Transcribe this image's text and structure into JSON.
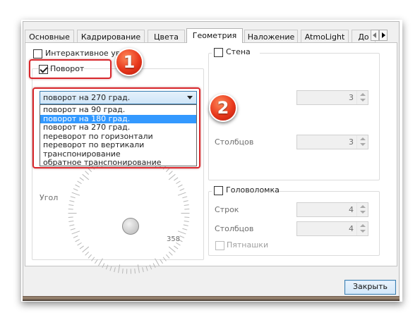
{
  "tabs": [
    {
      "label": "Основные",
      "active": false
    },
    {
      "label": "Кадрирование",
      "active": false
    },
    {
      "label": "Цвета",
      "active": false
    },
    {
      "label": "Геометрия",
      "active": true
    },
    {
      "label": "Наложение",
      "active": false
    },
    {
      "label": "AtmoLight",
      "active": false
    },
    {
      "label": "До",
      "active": false
    }
  ],
  "geometry": {
    "interactive_zoom": {
      "label": "Интерактивное увел",
      "checked": false
    },
    "rotate": {
      "label": "Поворот",
      "checked": true,
      "selected": "поворот на 270 град.",
      "options": [
        "поворот на 90 град.",
        "поворот на 180 град.",
        "поворот на 270 град.",
        "переворот по горизонтали",
        "переворот по вертикали",
        "транспонирование",
        "обратное транспонирование"
      ],
      "highlighted_option": "поворот на 180 град.",
      "angle_label": "Угол",
      "angle_value": "358"
    },
    "wall": {
      "label": "Стена",
      "checked": false,
      "columns_label": "Столбцов",
      "rows_value": "3",
      "columns_value": "3"
    },
    "puzzle": {
      "label": "Головоломка",
      "checked": false,
      "rows_label": "Строк",
      "rows_value": "4",
      "columns_label": "Столбцов",
      "columns_value": "4",
      "fifteen_label": "Пятнашки",
      "fifteen_checked": false
    }
  },
  "footer": {
    "close_label": "Закрыть"
  },
  "annotations": [
    {
      "number": "1",
      "target": "rotate-checkbox"
    },
    {
      "number": "2",
      "target": "rotate-dropdown"
    }
  ],
  "colors": {
    "highlight": "#d8262b",
    "selection": "#3399ff",
    "badge": "#e8381c"
  }
}
